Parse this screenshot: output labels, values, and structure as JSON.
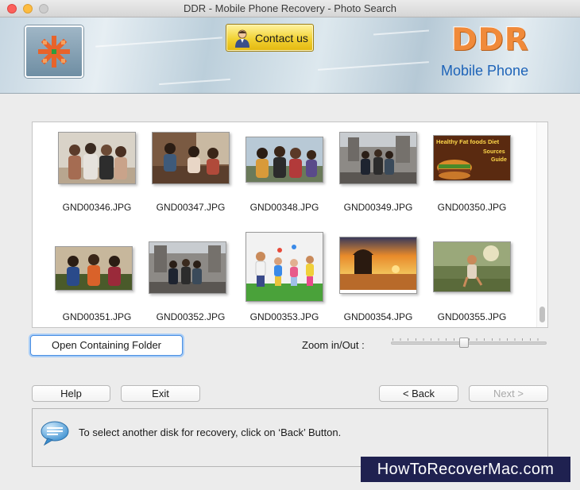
{
  "window": {
    "title": "DDR - Mobile Phone Recovery - Photo Search"
  },
  "header": {
    "contact_label": "Contact us",
    "brand_title": "DDR",
    "brand_subtitle": "Mobile Phone"
  },
  "gallery": {
    "items": [
      {
        "name": "GND00346.JPG"
      },
      {
        "name": "GND00347.JPG"
      },
      {
        "name": "GND00348.JPG"
      },
      {
        "name": "GND00349.JPG"
      },
      {
        "name": "GND00350.JPG",
        "caption_lines": [
          "Healthy Fat foods Diet",
          "Sources",
          "Guide"
        ]
      },
      {
        "name": "GND00351.JPG"
      },
      {
        "name": "GND00352.JPG"
      },
      {
        "name": "GND00353.JPG"
      },
      {
        "name": "GND00354.JPG"
      },
      {
        "name": "GND00355.JPG"
      }
    ]
  },
  "controls": {
    "open_folder_label": "Open Containing Folder",
    "zoom_label": "Zoom in/Out :",
    "zoom_level": 0.47
  },
  "buttons": {
    "help": "Help",
    "exit": "Exit",
    "back": "< Back",
    "next": "Next >"
  },
  "status": {
    "message": "To select another disk for recovery, click on ‘Back’ Button."
  },
  "watermark": "HowToRecoverMac.com",
  "colors": {
    "accent_blue": "#4a8fe2",
    "brand_orange": "#f08a3a",
    "brand_blue": "#1d63b8",
    "contact_yellow": "#f2d233"
  }
}
